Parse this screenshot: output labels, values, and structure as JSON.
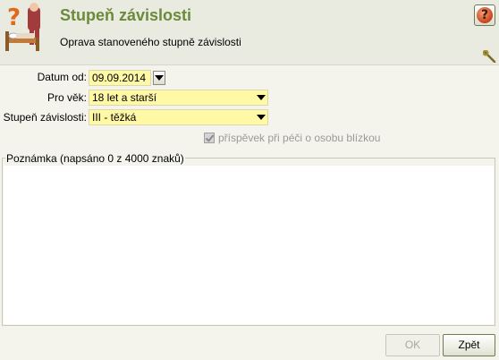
{
  "header": {
    "title": "Stupeň závislosti",
    "subtitle": "Oprava stanoveného stupně závislosti",
    "help_glyph": "?",
    "help_icon": "help-icon",
    "tool_icon": "wrench-icon"
  },
  "form": {
    "date_label": "Datum od:",
    "date_value": "09.09.2014",
    "age_label": "Pro věk:",
    "age_value": "18 let a starší",
    "level_label": "Stupeň závislosti:",
    "level_value": "III - těžká",
    "checkbox_label": "příspěvek při péči o osobu blízkou",
    "checkbox_checked": true,
    "checkbox_disabled": true
  },
  "note": {
    "legend": "Poznámka (napsáno 0 z 4000 znaků)",
    "value": ""
  },
  "buttons": {
    "ok_label": "OK",
    "back_label": "Zpět"
  },
  "colors": {
    "title": "#6b8a3a",
    "field_bg": "#fff8a4",
    "header_bg": "#e9eae0",
    "page_bg": "#f4f4ec"
  }
}
